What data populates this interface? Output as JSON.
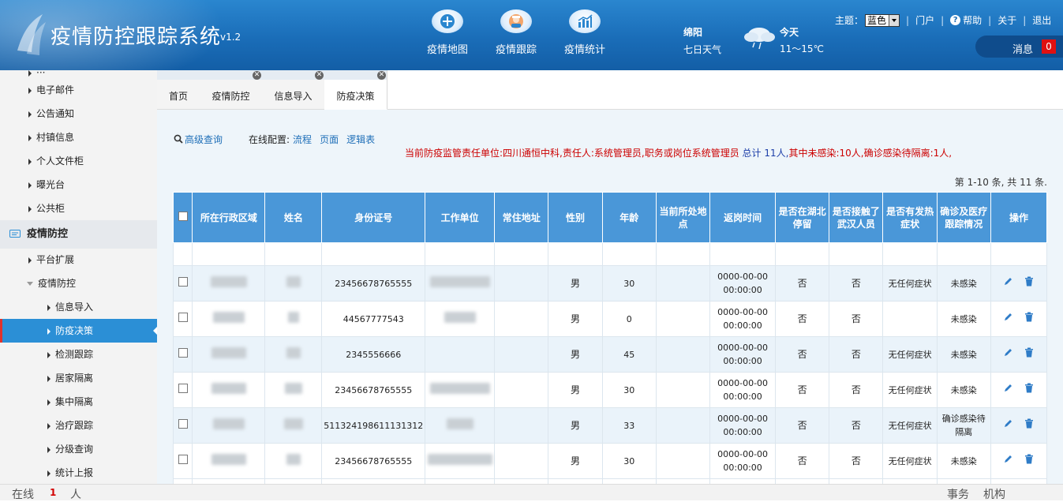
{
  "app": {
    "title": "疫情防控跟踪系统",
    "version": "v1.2"
  },
  "topnav": [
    {
      "label": "疫情地图",
      "icon": "map-plus-icon"
    },
    {
      "label": "疫情跟踪",
      "icon": "doctor-icon"
    },
    {
      "label": "疫情统计",
      "icon": "bar-chart-icon"
    }
  ],
  "weather": {
    "city": "绵阳",
    "week": "七日天气",
    "today": "今天",
    "temp": "11～15℃",
    "icon": "cloud-rain-icon"
  },
  "toplinks": {
    "theme_label": "主题：",
    "theme_value": "蓝色",
    "portal": "门户",
    "help": "帮助",
    "about": "关于",
    "logout": "退出"
  },
  "message": {
    "label": "消息",
    "count": "0"
  },
  "sidebar": {
    "items_top": [
      "电子邮件",
      "公告通知",
      "村镇信息",
      "个人文件柜",
      "曝光台",
      "公共柜"
    ],
    "group": "疫情防控",
    "items_mid": [
      "平台扩展",
      "疫情防控"
    ],
    "sub_items": [
      "信息导入",
      "防疫决策",
      "检测跟踪",
      "居家隔离",
      "集中隔离",
      "治疗跟踪",
      "分级查询",
      "统计上报"
    ],
    "active": "防疫决策"
  },
  "tabs": [
    {
      "label": "首页"
    },
    {
      "label": "疫情防控"
    },
    {
      "label": "信息导入"
    },
    {
      "label": "防疫决策"
    }
  ],
  "toolbar": {
    "search": "高级查询",
    "online_config": "在线配置:",
    "links": [
      "流程",
      "页面",
      "逻辑表"
    ]
  },
  "summary": {
    "prefix": "当前防疫监管责任单位:四川通恒中科,责任人:系统管理员,职务或岗位系统管理员",
    "total_label": "总计",
    "total": "11人,",
    "rest": "其中未感染:10人,确诊感染待隔离:1人,"
  },
  "pager": "第 1-10 条, 共 11 条.",
  "table": {
    "headers": [
      "所在行政区域",
      "姓名",
      "身份证号",
      "工作单位",
      "常住地址",
      "性别",
      "年龄",
      "当前所处地点",
      "返岗时间",
      "是否在湖北停留",
      "是否接触了武汉人员",
      "是否有发热症状",
      "确诊及医疗跟踪情况",
      "操作"
    ],
    "rows": [
      {
        "id": "23456678765555",
        "gender": "男",
        "age": "30",
        "time1": "0000-00-00",
        "time2": "00:00:00",
        "hubei": "否",
        "wuhan": "否",
        "fever": "无任何症状",
        "status": "未感染"
      },
      {
        "id": "44567777543",
        "gender": "男",
        "age": "0",
        "time1": "0000-00-00",
        "time2": "00:00:00",
        "hubei": "否",
        "wuhan": "否",
        "fever": "",
        "status": "未感染"
      },
      {
        "id": "2345556666",
        "gender": "男",
        "age": "45",
        "time1": "0000-00-00",
        "time2": "00:00:00",
        "hubei": "否",
        "wuhan": "否",
        "fever": "无任何症状",
        "status": "未感染"
      },
      {
        "id": "23456678765555",
        "gender": "男",
        "age": "30",
        "time1": "0000-00-00",
        "time2": "00:00:00",
        "hubei": "否",
        "wuhan": "否",
        "fever": "无任何症状",
        "status": "未感染"
      },
      {
        "id": "511324198611131312",
        "gender": "男",
        "age": "33",
        "time1": "0000-00-00",
        "time2": "00:00:00",
        "hubei": "否",
        "wuhan": "否",
        "fever": "无任何症状",
        "status": "确诊感染待隔离"
      },
      {
        "id": "23456678765555",
        "gender": "男",
        "age": "30",
        "time1": "0000-00-00",
        "time2": "00:00:00",
        "hubei": "否",
        "wuhan": "否",
        "fever": "无任何症状",
        "status": "未感染"
      }
    ]
  },
  "footer": {
    "online": "在线",
    "count": "1",
    "unit": "人",
    "affairs": "事务",
    "org": "机构"
  }
}
